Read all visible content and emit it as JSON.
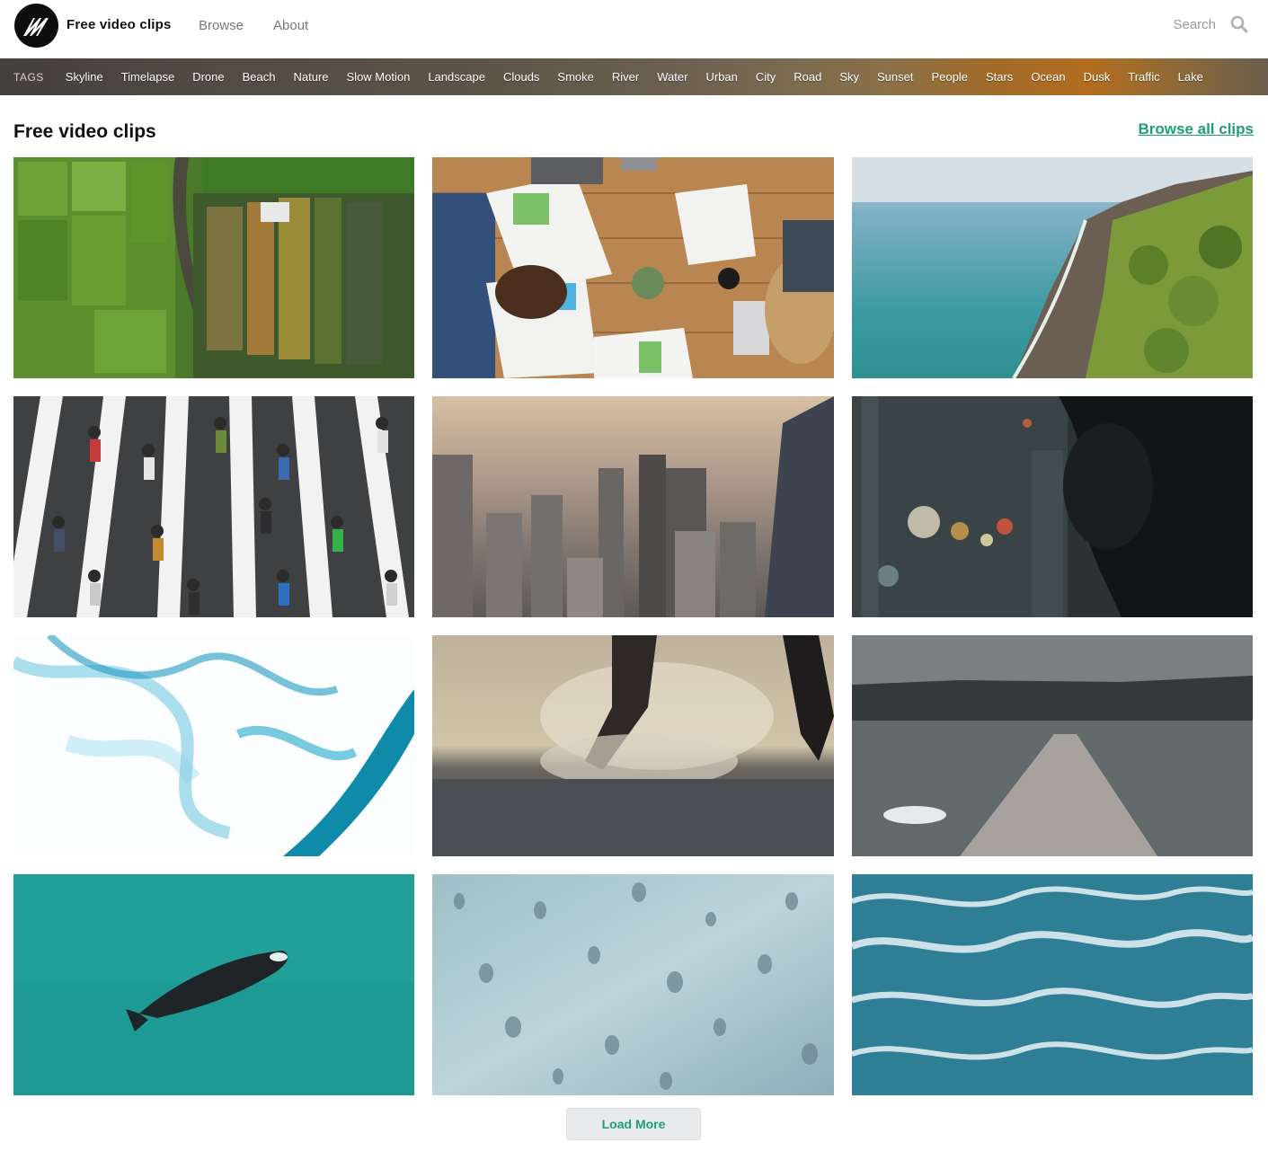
{
  "header": {
    "brand": "Free video clips",
    "nav": [
      {
        "label": "Browse"
      },
      {
        "label": "About"
      }
    ],
    "search": {
      "placeholder": "Search",
      "icon": "search-icon"
    }
  },
  "tags": {
    "label": "TAGS",
    "items": [
      "Skyline",
      "Timelapse",
      "Drone",
      "Beach",
      "Nature",
      "Slow Motion",
      "Landscape",
      "Clouds",
      "Smoke",
      "River",
      "Water",
      "Urban",
      "City",
      "Road",
      "Sky",
      "Sunset",
      "People",
      "Stars",
      "Ocean",
      "Dusk",
      "Traffic",
      "Lake"
    ]
  },
  "section": {
    "title": "Free video clips",
    "browse_all": "Browse all clips"
  },
  "clips": [
    {
      "subject": "aerial rice fields"
    },
    {
      "subject": "meeting table with papers"
    },
    {
      "subject": "coastline aerial"
    },
    {
      "subject": "crosswalk crowd"
    },
    {
      "subject": "hazy city skyline"
    },
    {
      "subject": "man at night window"
    },
    {
      "subject": "blue smoke"
    },
    {
      "subject": "foot splash in water"
    },
    {
      "subject": "pier on lake"
    },
    {
      "subject": "whale aerial"
    },
    {
      "subject": "rain drops on glass"
    },
    {
      "subject": "ocean waves"
    }
  ],
  "load_more": "Load More",
  "colors": {
    "accent": "#1e9e77",
    "logo_bg": "#0d0d0d"
  }
}
